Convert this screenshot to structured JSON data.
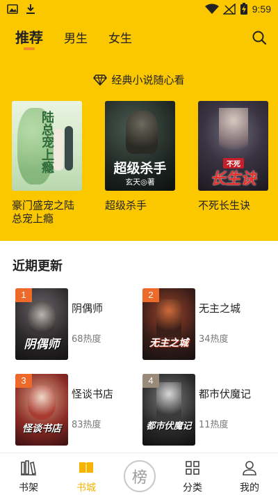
{
  "status_bar": {
    "time": "9:59"
  },
  "tabs": [
    {
      "label": "推荐",
      "active": true
    },
    {
      "label": "男生",
      "active": false
    },
    {
      "label": "女生",
      "active": false
    }
  ],
  "slogan": "经典小说随心看",
  "featured": [
    {
      "title": "豪门盛宠之陆总宠上瘾",
      "cover_text": "陆总宠上瘾"
    },
    {
      "title": "超级杀手",
      "cover_text": "超级杀手",
      "cover_author": "玄天◎著"
    },
    {
      "title": "不死长生诀",
      "cover_text": "长生诀",
      "cover_top": "不死"
    }
  ],
  "recent_title": "近期更新",
  "recent": [
    {
      "rank": "1",
      "title": "阴偶师",
      "heat": "68热度",
      "cover_text": "阴偶师",
      "rank_color": "#ee6a2a"
    },
    {
      "rank": "2",
      "title": "无主之城",
      "heat": "34热度",
      "cover_text": "无主之城",
      "rank_color": "#ee6a2a"
    },
    {
      "rank": "3",
      "title": "怪谈书店",
      "heat": "83热度",
      "cover_text": "怪谈书店",
      "rank_color": "#ee6a2a"
    },
    {
      "rank": "4",
      "title": "都市伏魔记",
      "heat": "11热度",
      "cover_text": "都市伏魔记",
      "rank_color": "#9a8a7a"
    }
  ],
  "bottom_nav": [
    {
      "label": "书架",
      "icon": "bookshelf-icon",
      "active": false
    },
    {
      "label": "书城",
      "icon": "book-open-icon",
      "active": true
    },
    {
      "label": "榜",
      "icon": "rank-icon",
      "active": false
    },
    {
      "label": "分类",
      "icon": "grid-icon",
      "active": false
    },
    {
      "label": "我的",
      "icon": "person-icon",
      "active": false
    }
  ],
  "colors": {
    "accent": "#fbc800",
    "active_nav": "#f5b400",
    "rank_badge": "#ee6a2a"
  }
}
